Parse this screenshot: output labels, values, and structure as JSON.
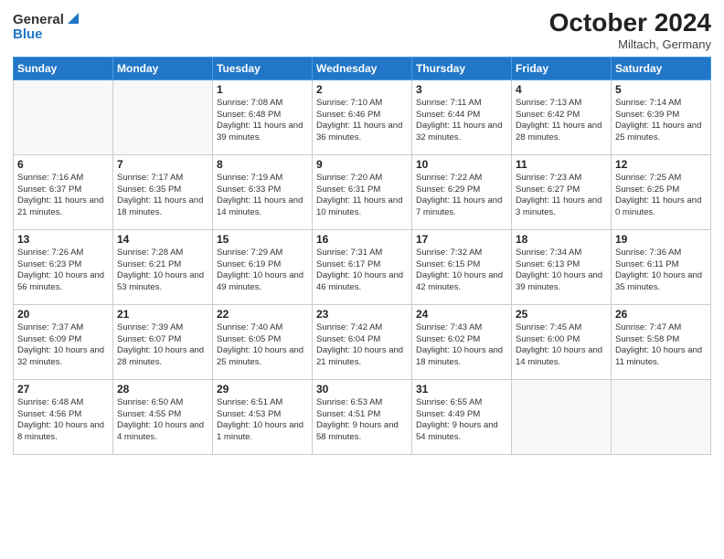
{
  "logo": {
    "general": "General",
    "blue": "Blue"
  },
  "title": "October 2024",
  "location": "Miltach, Germany",
  "days_of_week": [
    "Sunday",
    "Monday",
    "Tuesday",
    "Wednesday",
    "Thursday",
    "Friday",
    "Saturday"
  ],
  "weeks": [
    [
      {
        "day": "",
        "sunrise": "",
        "sunset": "",
        "daylight": ""
      },
      {
        "day": "",
        "sunrise": "",
        "sunset": "",
        "daylight": ""
      },
      {
        "day": "1",
        "sunrise": "Sunrise: 7:08 AM",
        "sunset": "Sunset: 6:48 PM",
        "daylight": "Daylight: 11 hours and 39 minutes."
      },
      {
        "day": "2",
        "sunrise": "Sunrise: 7:10 AM",
        "sunset": "Sunset: 6:46 PM",
        "daylight": "Daylight: 11 hours and 36 minutes."
      },
      {
        "day": "3",
        "sunrise": "Sunrise: 7:11 AM",
        "sunset": "Sunset: 6:44 PM",
        "daylight": "Daylight: 11 hours and 32 minutes."
      },
      {
        "day": "4",
        "sunrise": "Sunrise: 7:13 AM",
        "sunset": "Sunset: 6:42 PM",
        "daylight": "Daylight: 11 hours and 28 minutes."
      },
      {
        "day": "5",
        "sunrise": "Sunrise: 7:14 AM",
        "sunset": "Sunset: 6:39 PM",
        "daylight": "Daylight: 11 hours and 25 minutes."
      }
    ],
    [
      {
        "day": "6",
        "sunrise": "Sunrise: 7:16 AM",
        "sunset": "Sunset: 6:37 PM",
        "daylight": "Daylight: 11 hours and 21 minutes."
      },
      {
        "day": "7",
        "sunrise": "Sunrise: 7:17 AM",
        "sunset": "Sunset: 6:35 PM",
        "daylight": "Daylight: 11 hours and 18 minutes."
      },
      {
        "day": "8",
        "sunrise": "Sunrise: 7:19 AM",
        "sunset": "Sunset: 6:33 PM",
        "daylight": "Daylight: 11 hours and 14 minutes."
      },
      {
        "day": "9",
        "sunrise": "Sunrise: 7:20 AM",
        "sunset": "Sunset: 6:31 PM",
        "daylight": "Daylight: 11 hours and 10 minutes."
      },
      {
        "day": "10",
        "sunrise": "Sunrise: 7:22 AM",
        "sunset": "Sunset: 6:29 PM",
        "daylight": "Daylight: 11 hours and 7 minutes."
      },
      {
        "day": "11",
        "sunrise": "Sunrise: 7:23 AM",
        "sunset": "Sunset: 6:27 PM",
        "daylight": "Daylight: 11 hours and 3 minutes."
      },
      {
        "day": "12",
        "sunrise": "Sunrise: 7:25 AM",
        "sunset": "Sunset: 6:25 PM",
        "daylight": "Daylight: 11 hours and 0 minutes."
      }
    ],
    [
      {
        "day": "13",
        "sunrise": "Sunrise: 7:26 AM",
        "sunset": "Sunset: 6:23 PM",
        "daylight": "Daylight: 10 hours and 56 minutes."
      },
      {
        "day": "14",
        "sunrise": "Sunrise: 7:28 AM",
        "sunset": "Sunset: 6:21 PM",
        "daylight": "Daylight: 10 hours and 53 minutes."
      },
      {
        "day": "15",
        "sunrise": "Sunrise: 7:29 AM",
        "sunset": "Sunset: 6:19 PM",
        "daylight": "Daylight: 10 hours and 49 minutes."
      },
      {
        "day": "16",
        "sunrise": "Sunrise: 7:31 AM",
        "sunset": "Sunset: 6:17 PM",
        "daylight": "Daylight: 10 hours and 46 minutes."
      },
      {
        "day": "17",
        "sunrise": "Sunrise: 7:32 AM",
        "sunset": "Sunset: 6:15 PM",
        "daylight": "Daylight: 10 hours and 42 minutes."
      },
      {
        "day": "18",
        "sunrise": "Sunrise: 7:34 AM",
        "sunset": "Sunset: 6:13 PM",
        "daylight": "Daylight: 10 hours and 39 minutes."
      },
      {
        "day": "19",
        "sunrise": "Sunrise: 7:36 AM",
        "sunset": "Sunset: 6:11 PM",
        "daylight": "Daylight: 10 hours and 35 minutes."
      }
    ],
    [
      {
        "day": "20",
        "sunrise": "Sunrise: 7:37 AM",
        "sunset": "Sunset: 6:09 PM",
        "daylight": "Daylight: 10 hours and 32 minutes."
      },
      {
        "day": "21",
        "sunrise": "Sunrise: 7:39 AM",
        "sunset": "Sunset: 6:07 PM",
        "daylight": "Daylight: 10 hours and 28 minutes."
      },
      {
        "day": "22",
        "sunrise": "Sunrise: 7:40 AM",
        "sunset": "Sunset: 6:05 PM",
        "daylight": "Daylight: 10 hours and 25 minutes."
      },
      {
        "day": "23",
        "sunrise": "Sunrise: 7:42 AM",
        "sunset": "Sunset: 6:04 PM",
        "daylight": "Daylight: 10 hours and 21 minutes."
      },
      {
        "day": "24",
        "sunrise": "Sunrise: 7:43 AM",
        "sunset": "Sunset: 6:02 PM",
        "daylight": "Daylight: 10 hours and 18 minutes."
      },
      {
        "day": "25",
        "sunrise": "Sunrise: 7:45 AM",
        "sunset": "Sunset: 6:00 PM",
        "daylight": "Daylight: 10 hours and 14 minutes."
      },
      {
        "day": "26",
        "sunrise": "Sunrise: 7:47 AM",
        "sunset": "Sunset: 5:58 PM",
        "daylight": "Daylight: 10 hours and 11 minutes."
      }
    ],
    [
      {
        "day": "27",
        "sunrise": "Sunrise: 6:48 AM",
        "sunset": "Sunset: 4:56 PM",
        "daylight": "Daylight: 10 hours and 8 minutes."
      },
      {
        "day": "28",
        "sunrise": "Sunrise: 6:50 AM",
        "sunset": "Sunset: 4:55 PM",
        "daylight": "Daylight: 10 hours and 4 minutes."
      },
      {
        "day": "29",
        "sunrise": "Sunrise: 6:51 AM",
        "sunset": "Sunset: 4:53 PM",
        "daylight": "Daylight: 10 hours and 1 minute."
      },
      {
        "day": "30",
        "sunrise": "Sunrise: 6:53 AM",
        "sunset": "Sunset: 4:51 PM",
        "daylight": "Daylight: 9 hours and 58 minutes."
      },
      {
        "day": "31",
        "sunrise": "Sunrise: 6:55 AM",
        "sunset": "Sunset: 4:49 PM",
        "daylight": "Daylight: 9 hours and 54 minutes."
      },
      {
        "day": "",
        "sunrise": "",
        "sunset": "",
        "daylight": ""
      },
      {
        "day": "",
        "sunrise": "",
        "sunset": "",
        "daylight": ""
      }
    ]
  ]
}
